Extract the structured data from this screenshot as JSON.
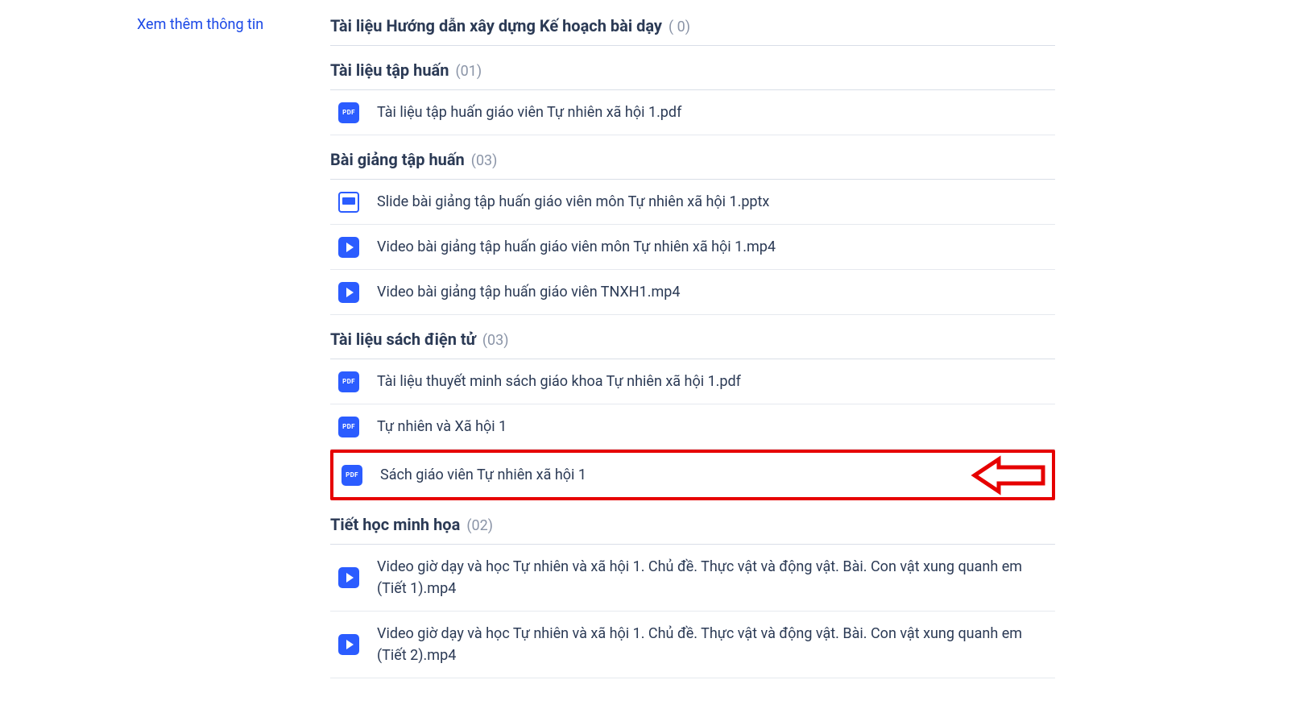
{
  "sidebar": {
    "more_info": "Xem thêm thông tin"
  },
  "sections": [
    {
      "title": "Tài liệu Hướng dẫn xây dựng Kế hoạch bài dạy",
      "count": "( 0)",
      "items": []
    },
    {
      "title": "Tài liệu tập huấn",
      "count": "(01)",
      "items": [
        {
          "icon": "pdf",
          "name": "Tài liệu tập huấn giáo viên Tự nhiên xã hội 1.pdf"
        }
      ]
    },
    {
      "title": "Bài giảng tập huấn",
      "count": "(03)",
      "items": [
        {
          "icon": "pptx",
          "name": "Slide bài giảng tập huấn giáo viên môn Tự nhiên xã hội 1.pptx"
        },
        {
          "icon": "video",
          "name": "Video bài giảng tập huấn giáo viên môn Tự nhiên xã hội 1.mp4"
        },
        {
          "icon": "video",
          "name": "Video bài giảng tập huấn giáo viên TNXH1.mp4"
        }
      ]
    },
    {
      "title": "Tài liệu sách điện tử",
      "count": "(03)",
      "items": [
        {
          "icon": "pdf",
          "name": "Tài liệu thuyết minh sách giáo khoa Tự nhiên xã hội 1.pdf"
        },
        {
          "icon": "pdf",
          "name": "Tự nhiên và Xã hội 1"
        },
        {
          "icon": "pdf",
          "name": "Sách giáo viên Tự nhiên xã hội 1",
          "highlight": true
        }
      ]
    },
    {
      "title": "Tiết học minh họa",
      "count": "(02)",
      "items": [
        {
          "icon": "video",
          "name": "Video giờ dạy và học Tự nhiên và xã hội 1. Chủ đề. Thực vật và động vật. Bài. Con vật xung quanh em (Tiết 1).mp4"
        },
        {
          "icon": "video",
          "name": "Video giờ dạy và học Tự nhiên và xã hội 1. Chủ đề. Thực vật và động vật. Bài. Con vật xung quanh em (Tiết 2).mp4"
        }
      ]
    }
  ]
}
